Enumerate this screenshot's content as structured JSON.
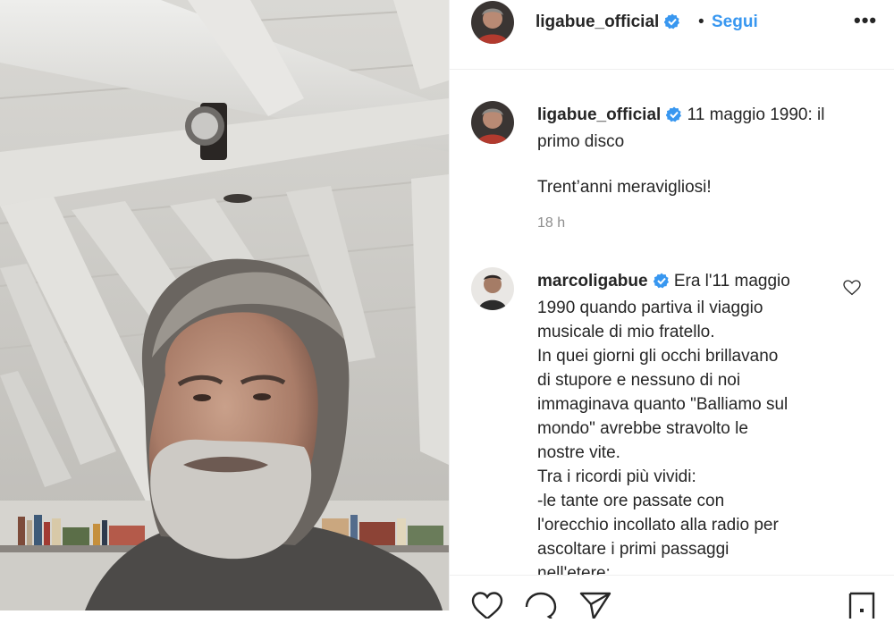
{
  "header": {
    "username": "ligabue_official",
    "separator": "•",
    "follow_label": "Segui",
    "more_label": "•••"
  },
  "caption": {
    "username": "ligabue_official",
    "text": "11 maggio 1990: il primo disco",
    "extra": "Trent’anni meravigliosi!",
    "time": "18 h"
  },
  "comment": {
    "username": "marcoligabue",
    "lines": [
      "Era l'11 maggio",
      "1990 quando partiva il viaggio",
      "musicale di mio fratello.",
      "In quei giorni gli occhi brillavano",
      "di stupore e nessuno di noi",
      "immaginava quanto \"Balliamo sul",
      "mondo\" avrebbe stravolto le",
      "nostre vite.",
      "Tra i ricordi più vividi:",
      "-le tante ore passate con",
      "l'orecchio incollato alla radio per",
      "ascoltare i primi passaggi",
      "nell'etere:"
    ]
  },
  "colors": {
    "link": "#3897f0",
    "verified": "#3897f0",
    "muted": "#8e8e8e",
    "text": "#262626"
  },
  "icons": {
    "like": "heart-icon",
    "comment": "comment-icon",
    "share": "paper-plane-icon",
    "save": "bookmark-icon",
    "verified": "verified-badge-icon",
    "more": "more-options-icon"
  }
}
